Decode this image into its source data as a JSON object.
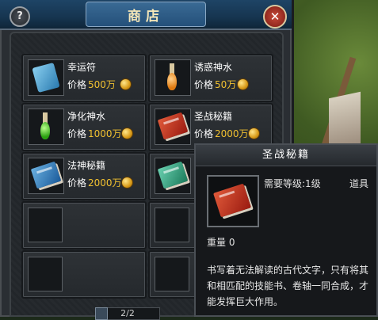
{
  "window": {
    "title": "商店"
  },
  "items": [
    {
      "name": "幸运符",
      "price_label": "价格",
      "price": "500万",
      "icon": "scroll-icon"
    },
    {
      "name": "诱惑神水",
      "price_label": "价格",
      "price": "50万",
      "icon": "orange-potion-icon"
    },
    {
      "name": "净化神水",
      "price_label": "价格",
      "price": "1000万",
      "icon": "green-potion-icon"
    },
    {
      "name": "圣战秘籍",
      "price_label": "价格",
      "price": "2000万",
      "icon": "red-book-icon"
    },
    {
      "name": "法神秘籍",
      "price_label": "价格",
      "price": "2000万",
      "icon": "blue-book-icon"
    }
  ],
  "pager": {
    "text": "2/2"
  },
  "tooltip": {
    "title": "圣战秘籍",
    "level_req": "需要等级:1级",
    "type": "道具",
    "weight": "重量 0",
    "description": "书写着无法解读的古代文字，只有将其和相匹配的技能书、卷轴一同合成，才能发挥巨大作用。"
  },
  "colors": {
    "price": "#f0c030",
    "title_text": "#f4e6b8",
    "titlebar": "#1e4466"
  }
}
